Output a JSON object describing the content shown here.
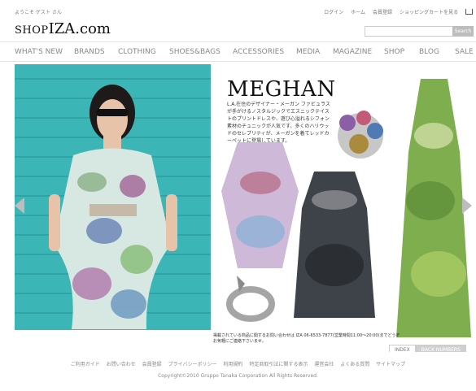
{
  "header": {
    "welcome": "ようこそ ゲスト さん",
    "links": [
      "ログイン",
      "ホーム",
      "会員登録",
      "ショッピングカートを見る"
    ],
    "logo_prefix": "SHOP",
    "logo_main": "IZA.com",
    "search_button": "Search"
  },
  "nav": {
    "items": [
      "WHAT'S NEW",
      "BRANDS",
      "CLOTHING",
      "SHOES&BAGS",
      "ACCESSORIES",
      "MEDIA",
      "MAGAZINE",
      "SHOP",
      "BLOG",
      "SALE"
    ]
  },
  "feature": {
    "headline": "MEGHAN",
    "description": "L.A.在住のデザイナー・メーガン ファビュラスが手がけるノスタルジックでエスニックテイストのプリントドレスや、遊び心溢れるシフォン素材のチュニックが人気です。多くのハリウッドのセレブリティが、メーガンを着てレッドカーペットに登場しています。",
    "note": "掲載されている商品に関するお問い合わせは IZA 06-6533-7877(営業時間11:00〜20:00)までどうぞお気軽にご連絡下さいませ。"
  },
  "tabs": [
    "INDEX",
    "BACK NUMBERS"
  ],
  "footer": {
    "links": [
      "ご利用ガイド",
      "お問い合わせ",
      "会員登録",
      "プライバシーポリシー",
      "利用規約",
      "特定商取引法に関する表示",
      "運営会社",
      "よくある質問",
      "サイトマップ"
    ],
    "copyright": "Copyright©2010 Gruppo Tanaka Corporation All Rights Reserved."
  },
  "colors": {
    "brick": "#3bb5b6",
    "nav_text": "#888888",
    "search_button": "#bdbdbd"
  }
}
